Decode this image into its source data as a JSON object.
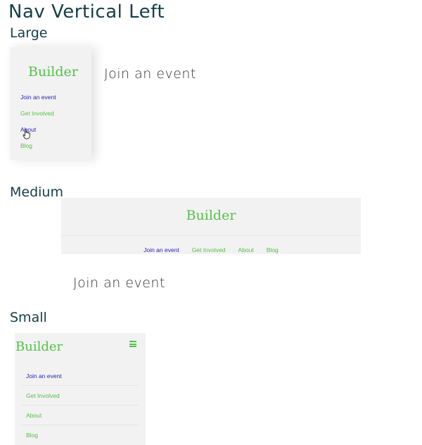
{
  "page_title": "Nav Vertical Left",
  "colors": {
    "heading": "#14404a",
    "brand": "#55c04a",
    "active_link": "#2a22b5",
    "nav_bg": "#f2f2f2"
  },
  "large": {
    "section_title": "Large",
    "brand": "Builder",
    "links": [
      "Join an event",
      "Get Involved",
      "About",
      "Blog"
    ],
    "content_heading": "Join an event",
    "cursor_icon": "hand-pointer-icon"
  },
  "medium": {
    "section_title": "Medium",
    "brand": "Builder",
    "links": [
      "Join an event",
      "Get Involved",
      "About",
      "Blog"
    ],
    "content_heading": "Join an event"
  },
  "small": {
    "section_title": "Small",
    "brand": "Builder",
    "menu_icon": "hamburger-icon",
    "links": [
      "Join an event",
      "Get Involved",
      "About",
      "Blog"
    ]
  }
}
